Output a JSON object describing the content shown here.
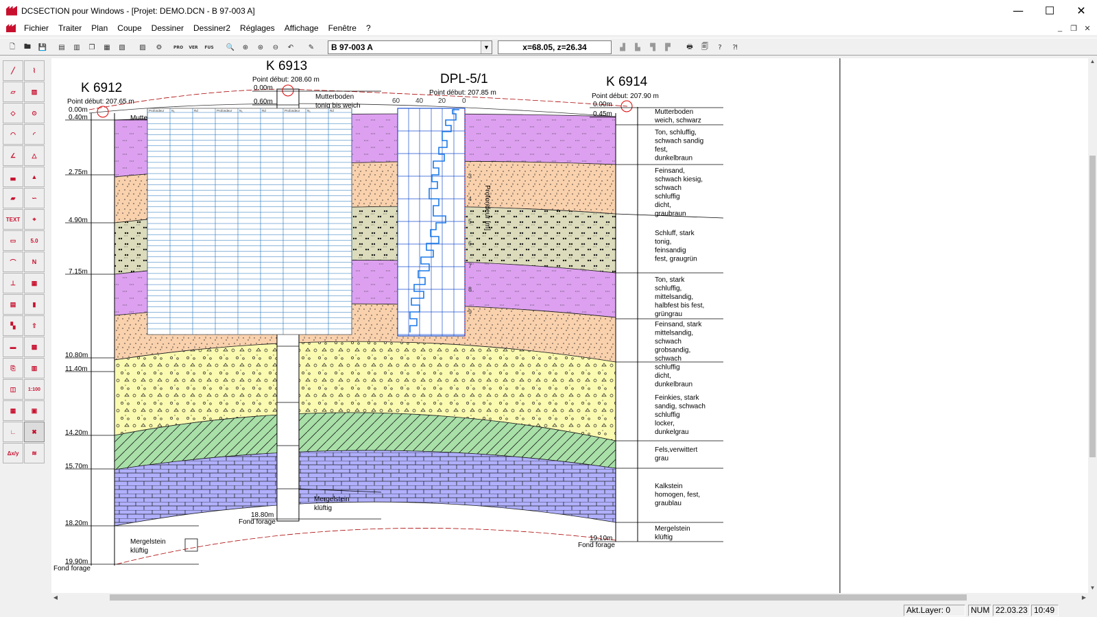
{
  "window": {
    "title": "DCSECTION pour Windows - [Projet: DEMO.DCN - B 97-003 A]",
    "minimize": "—",
    "maximize": "☐",
    "close": "✕"
  },
  "menu": [
    "Fichier",
    "Traiter",
    "Plan",
    "Coupe",
    "Dessiner",
    "Dessiner2",
    "Réglages",
    "Affichage",
    "Fenêtre",
    "?"
  ],
  "toolbar": {
    "layer_value": "B 97-003 A",
    "coords": "x=68.05, z=26.34",
    "labels": {
      "pro": "PRO",
      "ver": "VER",
      "fus": "FUS"
    }
  },
  "lefttools": {
    "text_label": "TEXT",
    "value_label": "5.0",
    "north_label": "N",
    "scale_label": "1:100",
    "axy_label": "Δx/y"
  },
  "section": {
    "boreholes": [
      {
        "name": "K 6912",
        "start": "Point début: 207.65 m",
        "top": "0.00m",
        "bottom_note": "Fond forage"
      },
      {
        "name": "K 6913",
        "start": "Point début: 208.60 m",
        "top": "0.00m",
        "bottom_note": "Fond forage"
      },
      {
        "name": "DPL-5/1",
        "start": "Point début: 207.85 m"
      },
      {
        "name": "K 6914",
        "start": "Point début: 207.90 m",
        "top": "0.00m",
        "bottom_note": "Fond forage"
      }
    ],
    "depths_left": [
      "0.40m",
      "2.75m",
      "4.90m",
      "7.15m",
      "10.80m",
      "11.40m",
      "14.20m",
      "15.70m",
      "18.20m",
      "19.90m"
    ],
    "depths_k6913": [
      "0.60m",
      "18.80m"
    ],
    "depths_k6914": [
      "0.45m",
      "19.10m"
    ],
    "k6913_top_label": "Mutterboden",
    "k6913_top_label2": "tonig bis weich",
    "k6913_bottom_label": "Mergelstein",
    "k6913_bottom_label2": "klüftig",
    "k6912_top_label": "Mutterb",
    "k6912_bottom_label": "Mergelstein",
    "k6912_bottom_label2": "klüftig",
    "dpl_axis": [
      "60",
      "40",
      "20",
      "0"
    ],
    "dpl_depths": [
      "3",
      "4",
      "5",
      "6",
      "7",
      "8",
      "9"
    ],
    "dpl_side_label": "Profondeur [m]",
    "table_headers": [
      "Profondeur",
      "N₁",
      "Rd",
      "Profondeur",
      "N₁",
      "Rd",
      "Profondeur",
      "N₁",
      "Rd"
    ],
    "legend": [
      [
        "Mutterboden",
        "weich, schwarz"
      ],
      [
        "Ton, schluffig,",
        "schwach sandig",
        "fest,",
        "dunkelbraun"
      ],
      [
        "Feinsand,",
        "schwach kiesig,",
        "schwach",
        "schluffig",
        "dicht,",
        "graubraun"
      ],
      [
        "Schluff, stark",
        "tonig,",
        "feinsandig",
        "fest, graugrün"
      ],
      [
        "Ton, stark",
        "schluffig,",
        "mittelsandig,",
        "halbfest bis fest,",
        "grüngrau"
      ],
      [
        "Feinsand, stark",
        "mittelsandig,",
        "schwach",
        "grobsandig,",
        "schwach",
        "schluffig",
        "dicht,",
        "dunkelbraun"
      ],
      [
        "Feinkies, stark",
        "sandig, schwach",
        "schluffig",
        "locker,",
        "dunkelgrau"
      ],
      [
        "Fels,verwittert",
        "grau"
      ],
      [
        "Kalkstein",
        "homogen, fest,",
        "graublau"
      ],
      [
        "Mergelstein",
        "klüftig"
      ]
    ]
  },
  "status": {
    "layer": "Akt.Layer: 0",
    "num": "NUM",
    "date": "22.03.23",
    "time": "10:49"
  }
}
